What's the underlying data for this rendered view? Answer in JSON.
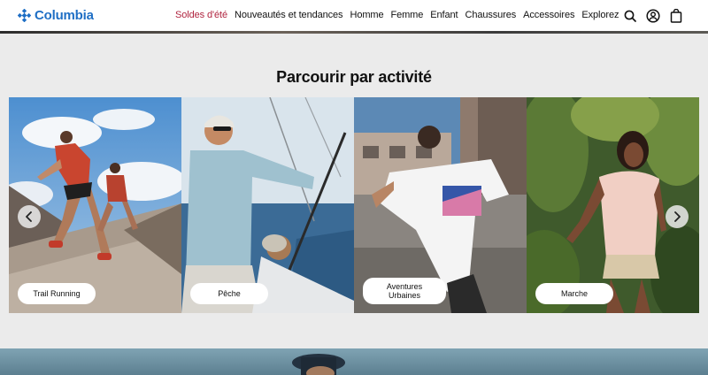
{
  "brand": {
    "name": "Columbia"
  },
  "nav": {
    "items": [
      {
        "label": "Soldes d'été",
        "sale": true
      },
      {
        "label": "Nouveautés et tendances"
      },
      {
        "label": "Homme"
      },
      {
        "label": "Femme"
      },
      {
        "label": "Enfant"
      },
      {
        "label": "Chaussures"
      },
      {
        "label": "Accessoires"
      },
      {
        "label": "Explorez"
      }
    ]
  },
  "icons": [
    "search-icon",
    "account-icon",
    "cart-icon"
  ],
  "activities": {
    "title": "Parcourir par activité",
    "cards": [
      {
        "label": "Trail Running"
      },
      {
        "label": "Pêche"
      },
      {
        "label": "Aventures Urbaines"
      },
      {
        "label": "Marche"
      }
    ]
  },
  "colors": {
    "sale": "#b0243f",
    "brand": "#1f6fc5",
    "page_bg": "#ebebeb"
  }
}
